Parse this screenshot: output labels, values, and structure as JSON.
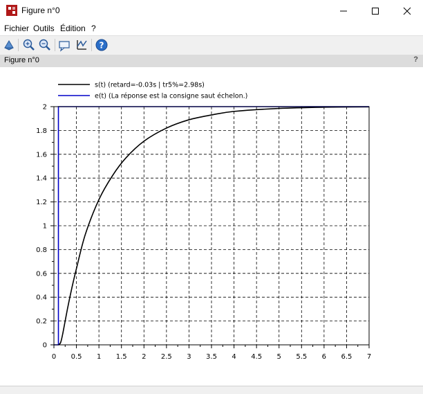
{
  "window": {
    "title": "Figure n°0",
    "minimize_icon": "minimize-icon",
    "maximize_icon": "maximize-icon",
    "close_icon": "close-icon"
  },
  "menu": {
    "items": [
      {
        "label": "Fichier"
      },
      {
        "label": "Outils"
      },
      {
        "label": "Édition"
      },
      {
        "label": "?"
      }
    ]
  },
  "toolbar": {
    "tools": [
      "rotate-icon",
      "zoom-in-icon",
      "zoom-out-icon",
      "datatip-icon",
      "edit-axes-icon",
      "help-icon"
    ]
  },
  "figure_bar": {
    "title": "Figure n°0",
    "help": "?"
  },
  "chart_data": {
    "type": "line",
    "xlim": [
      0,
      7
    ],
    "ylim": [
      0,
      2
    ],
    "x_ticks": [
      "0",
      "0.5",
      "1",
      "1.5",
      "2",
      "2.5",
      "3",
      "3.5",
      "4",
      "4.5",
      "5",
      "5.5",
      "6",
      "6.5",
      "7"
    ],
    "y_ticks": [
      "0",
      "0.2",
      "0.4",
      "0.6",
      "0.8",
      "1",
      "1.2",
      "1.4",
      "1.6",
      "1.8",
      "2"
    ],
    "grid": true,
    "legend_position": "top-left",
    "series": [
      {
        "name": "s(t) (retard=-0.03s | tr5%=2.98s)",
        "color": "#000000",
        "x": [
          0.1,
          0.15,
          0.2,
          0.3,
          0.4,
          0.5,
          0.7,
          1.0,
          1.3,
          1.6,
          2.0,
          2.5,
          3.0,
          3.5,
          4.0,
          5.0,
          6.0,
          7.0
        ],
        "y": [
          0.0,
          0.02,
          0.1,
          0.3,
          0.48,
          0.64,
          0.93,
          1.22,
          1.42,
          1.57,
          1.71,
          1.82,
          1.89,
          1.93,
          1.96,
          1.985,
          1.995,
          1.998
        ]
      },
      {
        "name": "e(t) (La réponse est la consigne saut échelon.)",
        "color": "#0000c8",
        "x": [
          0,
          0.1,
          0.1,
          0.1,
          7.0
        ],
        "y": [
          0,
          0,
          1.46,
          2.0,
          2.0
        ]
      }
    ]
  }
}
